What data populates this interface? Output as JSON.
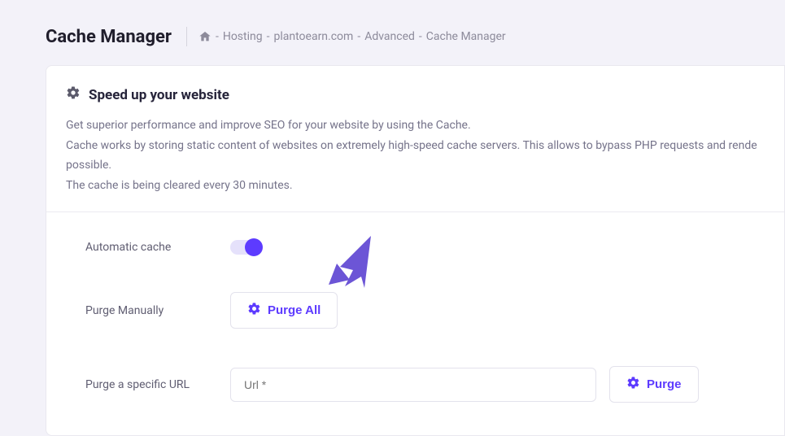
{
  "header": {
    "title": "Cache Manager",
    "breadcrumb": {
      "sep0": "-",
      "item1": "Hosting",
      "sep1": "-",
      "item2": "plantoearn.com",
      "sep2": "-",
      "item3": "Advanced",
      "sep3": "-",
      "item4": "Cache Manager"
    }
  },
  "section": {
    "title": "Speed up your website",
    "desc_line1": "Get superior performance and improve SEO for your website by using the Cache.",
    "desc_line2": "Cache works by storing static content of websites on extremely high-speed cache servers. This allows to bypass PHP requests and rende",
    "desc_line3": "possible.",
    "desc_line4": "The cache is being cleared every 30 minutes."
  },
  "controls": {
    "automatic_cache_label": "Automatic cache",
    "purge_manually_label": "Purge Manually",
    "purge_all_button": "Purge All",
    "purge_specific_label": "Purge a specific URL",
    "url_placeholder": "Url *",
    "purge_button": "Purge"
  },
  "colors": {
    "accent": "#5d3bff"
  }
}
